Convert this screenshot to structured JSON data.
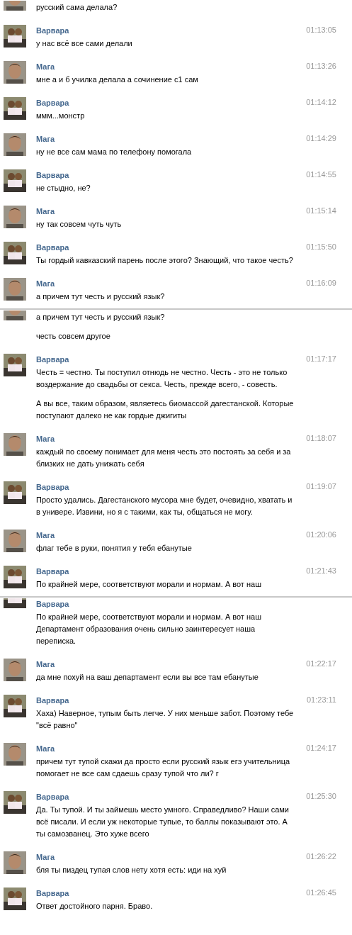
{
  "segments": [
    {
      "messages": [
        {
          "kind": "male",
          "partial_top": true,
          "paragraphs": [
            "русский сама делала?"
          ]
        },
        {
          "kind": "female",
          "author": "Варвара",
          "time": "01:13:05",
          "paragraphs": [
            "у нас всё все сами делали"
          ]
        },
        {
          "kind": "male",
          "author": "Мага",
          "time": "01:13:26",
          "paragraphs": [
            "мне а и б училка делала а сочинение с1 сам"
          ]
        },
        {
          "kind": "female",
          "author": "Варвара",
          "time": "01:14:12",
          "paragraphs": [
            "ммм...монстр"
          ]
        },
        {
          "kind": "male",
          "author": "Мага",
          "time": "01:14:29",
          "paragraphs": [
            "ну не все сам мама по телефону помогала"
          ]
        },
        {
          "kind": "female",
          "author": "Варвара",
          "time": "01:14:55",
          "paragraphs": [
            "не стыдно, не?"
          ]
        },
        {
          "kind": "male",
          "author": "Мага",
          "time": "01:15:14",
          "paragraphs": [
            "ну так совсем чуть чуть"
          ]
        },
        {
          "kind": "female",
          "author": "Варвара",
          "time": "01:15:50",
          "paragraphs": [
            "Ты гордый кавказский парень после этого? Знающий, что такое честь?"
          ]
        },
        {
          "kind": "male",
          "author": "Мага",
          "time": "01:16:09",
          "paragraphs": [
            "а причем тут честь и русский язык?"
          ]
        }
      ]
    },
    {
      "messages": [
        {
          "kind": "male",
          "partial_top": true,
          "paragraphs": [
            "а причем тут честь и русский язык?",
            "честь совсем другое"
          ]
        },
        {
          "kind": "female",
          "author": "Варвара",
          "time": "01:17:17",
          "paragraphs": [
            "Честь = честно. Ты поступил отнюдь не честно. Честь - это не только воздержание до свадьбы от секса. Честь, прежде всего, - совесть.",
            "А вы все, таким образом, являетесь биомассой дагестанской. Которые поступают далеко не как гордые джигиты"
          ]
        },
        {
          "kind": "male",
          "author": "Мага",
          "time": "01:18:07",
          "paragraphs": [
            "каждый по своему понимает для меня честь это постоять за себя и за близких не дать унижать себя"
          ]
        },
        {
          "kind": "female",
          "author": "Варвара",
          "time": "01:19:07",
          "paragraphs": [
            "Просто удались. Дагестанского мусора мне будет, очевидно, хватать и в универе. Извини, но я с такими, как ты, общаться не могу."
          ]
        },
        {
          "kind": "male",
          "author": "Мага",
          "time": "01:20:06",
          "paragraphs": [
            "флаг тебе в руки, понятия у тебя ебанутые"
          ]
        },
        {
          "kind": "female",
          "author": "Варвара",
          "time": "01:21:43",
          "paragraphs": [
            "По крайней мере, соответствуют морали и нормам. А вот наш"
          ]
        }
      ]
    },
    {
      "messages": [
        {
          "kind": "female",
          "author": "Варвара",
          "partial_top": true,
          "paragraphs": [
            "По крайней мере, соответствуют морали и нормам. А вот наш Департамент образования очень сильно заинтересует наша переписка."
          ]
        },
        {
          "kind": "male",
          "author": "Мага",
          "time": "01:22:17",
          "paragraphs": [
            "да мне похуй на ваш департамент если вы все там ебанутые"
          ]
        },
        {
          "kind": "female",
          "author": "Варвара",
          "time": "01:23:11",
          "paragraphs": [
            "Хаха) Наверное, тупым быть легче. У них меньше забот. Поэтому тебе \"всё равно\""
          ]
        },
        {
          "kind": "male",
          "author": "Мага",
          "time": "01:24:17",
          "paragraphs": [
            "причем тут тупой скажи да просто если русский язык егэ учительница помогает не все сам сдаешь сразу тупой что ли? г"
          ]
        },
        {
          "kind": "female",
          "author": "Варвара",
          "time": "01:25:30",
          "paragraphs": [
            "Да. Ты тупой. И ты займешь место умного. Справедливо? Наши сами всё писали. И если уж некоторые тупые, то баллы показывают это. А ты самозванец. Это хуже всего"
          ]
        },
        {
          "kind": "male",
          "author": "Мага",
          "time": "01:26:22",
          "paragraphs": [
            "бля ты пиздец тупая слов нету хотя есть: иди на хуй"
          ]
        },
        {
          "kind": "female",
          "author": "Варвара",
          "time": "01:26:45",
          "paragraphs": [
            "Ответ достойного парня. Браво."
          ]
        }
      ]
    }
  ]
}
